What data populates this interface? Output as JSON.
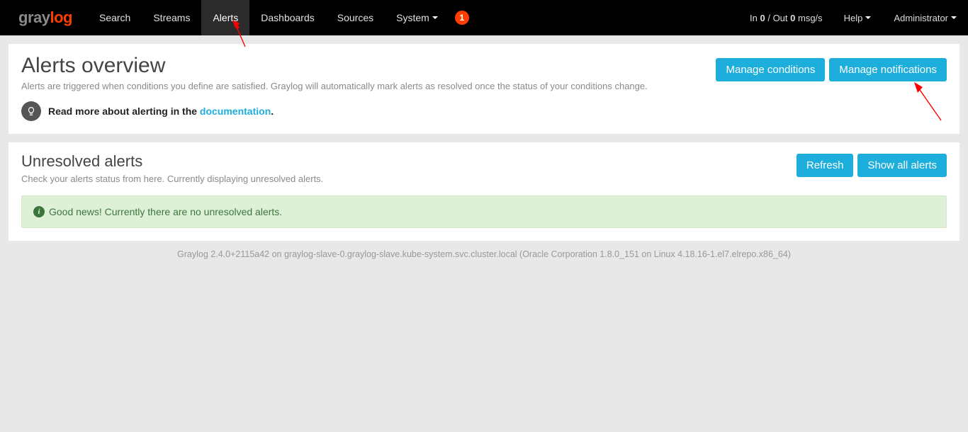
{
  "nav": {
    "brand_gray": "gray",
    "brand_orange": "log",
    "items": [
      "Search",
      "Streams",
      "Alerts",
      "Dashboards",
      "Sources",
      "System"
    ],
    "active_index": 2,
    "dropdown_indices": [
      5
    ],
    "notif_count": "1",
    "inout_prefix": "In ",
    "inout_in": "0",
    "inout_mid": " / Out ",
    "inout_out": "0",
    "inout_suffix": " msg/s",
    "help": "Help",
    "user": "Administrator"
  },
  "overview": {
    "title": "Alerts overview",
    "subtitle": "Alerts are triggered when conditions you define are satisfied. Graylog will automatically mark alerts as resolved once the status of your conditions change.",
    "btn_conditions": "Manage conditions",
    "btn_notifications": "Manage notifications",
    "doc_prefix": "Read more about alerting in the ",
    "doc_link": "documentation",
    "doc_suffix": "."
  },
  "unresolved": {
    "title": "Unresolved alerts",
    "subtitle": "Check your alerts status from here. Currently displaying unresolved alerts.",
    "btn_refresh": "Refresh",
    "btn_showall": "Show all alerts",
    "good_news": "Good news! Currently there are no unresolved alerts."
  },
  "footer": "Graylog 2.4.0+2115a42 on graylog-slave-0.graylog-slave.kube-system.svc.cluster.local (Oracle Corporation 1.8.0_151 on Linux 4.18.16-1.el7.elrepo.x86_64)"
}
